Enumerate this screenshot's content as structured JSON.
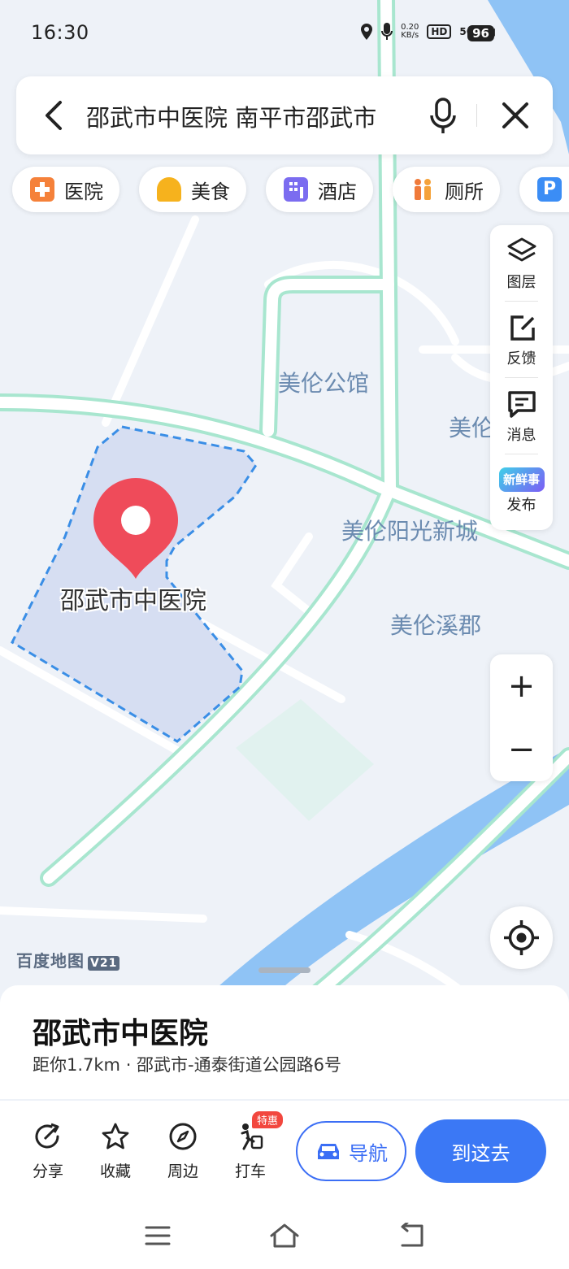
{
  "status_bar": {
    "time": "16:30",
    "net_speed_value": "0.20",
    "net_speed_unit": "KB/s",
    "hd_badge": "HD",
    "signal": "5G",
    "battery": "96"
  },
  "search": {
    "query": "邵武市中医院 南平市邵武市",
    "icons": [
      "back-arrow-icon",
      "microphone-icon",
      "close-icon"
    ]
  },
  "categories": [
    {
      "label": "医院",
      "icon": "hospital-icon",
      "color": "#f5813a"
    },
    {
      "label": "美食",
      "icon": "food-icon",
      "color": "#f6b21d"
    },
    {
      "label": "酒店",
      "icon": "hotel-icon",
      "color": "#7b6cf0"
    },
    {
      "label": "厕所",
      "icon": "toilet-icon",
      "color": "#f07a3a"
    },
    {
      "label": "",
      "icon": "parking-icon",
      "color": "#3b8df5"
    }
  ],
  "map_tools": [
    {
      "label": "图层",
      "icon": "layers-icon"
    },
    {
      "label": "反馈",
      "icon": "feedback-icon"
    },
    {
      "label": "消息",
      "icon": "message-icon"
    },
    {
      "label": "发布",
      "icon": "new-post-icon",
      "badge_text": "新鲜事"
    }
  ],
  "zoom": {
    "in": "+",
    "out": "−"
  },
  "map": {
    "labels": [
      "美伦公馆",
      "美伦",
      "美伦阳光新城",
      "美伦溪郡"
    ],
    "selected_poi": "邵武市中医院",
    "logo": "百度地图",
    "logo_version": "V21",
    "colors": {
      "background": "#eef2f8",
      "road_outline": "#a8e6cf",
      "river": "#8fc3f5",
      "area_fill": "#d6def2",
      "area_border": "#3a8ee6",
      "pin": "#ef4b5a"
    }
  },
  "place": {
    "name": "邵武市中医院",
    "subtitle": "距你1.7km · 邵武市-通泰街道公园路6号"
  },
  "actions": [
    {
      "label": "分享",
      "icon": "share-icon"
    },
    {
      "label": "收藏",
      "icon": "star-icon"
    },
    {
      "label": "周边",
      "icon": "compass-icon"
    },
    {
      "label": "打车",
      "icon": "taxi-icon",
      "tag": "特惠"
    }
  ],
  "buttons": {
    "navigate": "导航",
    "go_here": "到这去",
    "accent": "#3b78f5"
  },
  "system_nav": [
    "menu-icon",
    "home-icon",
    "back-icon"
  ]
}
